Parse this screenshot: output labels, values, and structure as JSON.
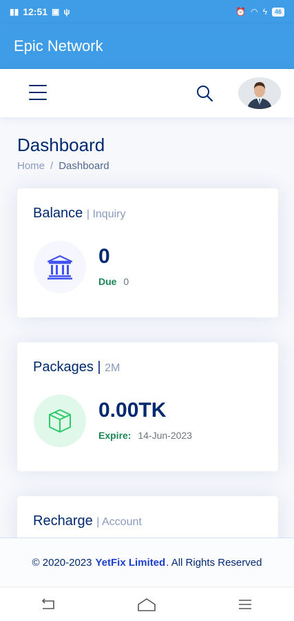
{
  "status_bar": {
    "time": "12:51",
    "battery": "46"
  },
  "app_bar": {
    "title": "Epic Network"
  },
  "page": {
    "title": "Dashboard",
    "breadcrumb": [
      "Home",
      "/",
      "Dashboard"
    ]
  },
  "cards": {
    "balance": {
      "title": "Balance",
      "subtitle": "| Inquiry",
      "value": "0",
      "due_label": "Due",
      "due_value": "0"
    },
    "packages": {
      "title": "Packages |",
      "subtitle": "2M",
      "value": "0.00TK",
      "expire_label": "Expire:",
      "expire_value": "14-Jun-2023"
    },
    "recharge": {
      "title": "Recharge",
      "subtitle": "| Account"
    }
  },
  "footer": {
    "prefix": "© 2020-2023",
    "brand": "YetFix Limited",
    "suffix": ". All Rights Reserved"
  },
  "colors": {
    "app_bar": "#3f9ce6",
    "heading": "#012970",
    "success": "#198754",
    "brand_link": "#1b3fd1"
  },
  "icons": [
    "hamburger-menu-icon",
    "search-icon",
    "bank-icon",
    "box-icon",
    "back-icon",
    "home-icon",
    "menu-icon"
  ]
}
